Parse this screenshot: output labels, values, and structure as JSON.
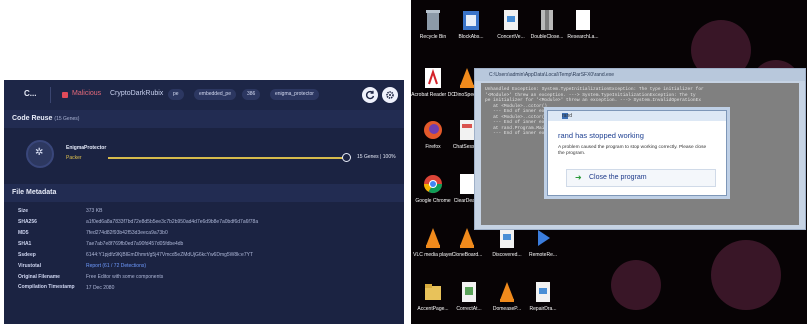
{
  "left_panel": {
    "back_label": "C...",
    "malicious_label": "Malicious",
    "file_name": "CryptoDarkRubix",
    "tags": [
      "pe",
      "embedded_pe",
      "386",
      "enigma_protector"
    ],
    "code_reuse": {
      "title": "Code Reuse",
      "count_label": "(15 Genes)",
      "item_name": "EnigmaProtector",
      "item_type": "Packer",
      "value_label": "15 Genes | 100%",
      "percent": 100
    },
    "file_metadata": {
      "title": "File Metadata",
      "rows": [
        {
          "key": "Size",
          "value": "373 KB"
        },
        {
          "key": "SHA256",
          "value": "a1f0ed6a8a7833f7bd72e8d5b5ee3c7b2b950ad4d7e6d9b8e7a0bdf6d7a6f78a"
        },
        {
          "key": "MD5",
          "value": "7fed274d82f93b42f53d3eeca9a73b0"
        },
        {
          "key": "SHA1",
          "value": "7ae7ab7e8f769fb0ed7a90fd457d05fdbe4db"
        },
        {
          "key": "Ssdeep",
          "value": "6144:Y1pjdfz9KjBIEmDhmrt/g5j47Vmcd5eZMdUjG6kcYw6Dmg5W8k:e7YT"
        },
        {
          "key": "Virustotal",
          "value": "Report (61 / 72 Detections)",
          "link": true
        },
        {
          "key": "Original Filename",
          "value": "Free Editor with some components"
        },
        {
          "key": "Compilation Timestamp",
          "value": "17 Dec 2080"
        }
      ]
    }
  },
  "right_panel": {
    "desktop_icons": [
      {
        "label": "Recycle Bin"
      },
      {
        "label": "BlockAbs..."
      },
      {
        "label": "ConcertVe..."
      },
      {
        "label": "DoubleClose..."
      },
      {
        "label": "ResearchLa..."
      },
      {
        "label": "Acrobat Reader DC"
      },
      {
        "label": "DinoSpee..."
      },
      {
        "label": "Firefox"
      },
      {
        "label": "ChatSession"
      },
      {
        "label": "Google Chrome"
      },
      {
        "label": "ClearDeal..."
      },
      {
        "label": "VLC media player"
      },
      {
        "label": "CloneBoard..."
      },
      {
        "label": "Discovered..."
      },
      {
        "label": "RemoteRe..."
      },
      {
        "label": "AccentPage..."
      },
      {
        "label": "CorrectAt..."
      },
      {
        "label": "DomeaseP..."
      },
      {
        "label": "RepairDra..."
      }
    ],
    "cmd_window": {
      "title": "C:\\Users\\admin\\AppData\\Local\\Temp\\RarSFX0\\rand.exe",
      "lines": [
        "Unhandled Exception: System.TypeInitializationException: The type initializer for",
        "'<Module>' threw an exception. ---> System.TypeInitializationException: The ty",
        "pe initializer for '<Module>' threw an exception. ---> System.InvalidOperationEx",
        "   at <Module>..cctor()",
        "   --- End of inner exception stack trace ---",
        "   at <Module>..cctor()",
        "   --- End of inner exception stack trace ---",
        "   at rand.Program.Main(String[] args)",
        "   --- End of inner exception stack trace ---"
      ]
    },
    "dialog": {
      "title": "rand",
      "heading": "rand has stopped working",
      "message": "A problem caused the program to stop working correctly. Please close the program.",
      "button_label": "Close the program"
    }
  }
}
